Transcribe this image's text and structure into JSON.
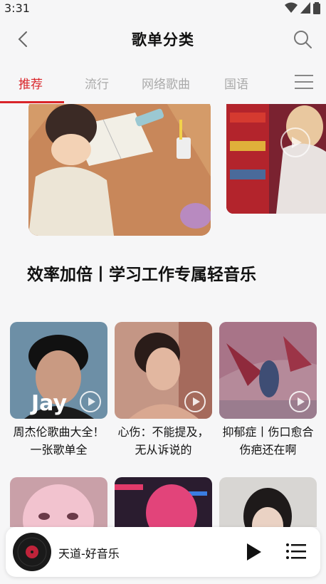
{
  "status": {
    "time": "3:31"
  },
  "header": {
    "title": "歌单分类"
  },
  "tabs": [
    {
      "label": "推荐",
      "active": true
    },
    {
      "label": "流行",
      "active": false
    },
    {
      "label": "网络歌曲",
      "active": false
    },
    {
      "label": "国语",
      "active": false
    }
  ],
  "featured": {
    "title": "效率加倍丨学习工作专属轻音乐"
  },
  "playlists": [
    {
      "title": "周杰伦歌曲大全！一张歌单全"
    },
    {
      "title": "心伤：不能提及，无从诉说的"
    },
    {
      "title": "抑郁症丨伤口愈合伤疤还在啊"
    }
  ],
  "mini_player": {
    "song": "天道-好音乐"
  },
  "colors": {
    "accent": "#d9252a",
    "background": "#f6f6f7"
  },
  "icons": [
    "back-arrow-icon",
    "search-icon",
    "menu-icon",
    "play-icon",
    "playlist-icon",
    "vinyl-disc-icon"
  ]
}
